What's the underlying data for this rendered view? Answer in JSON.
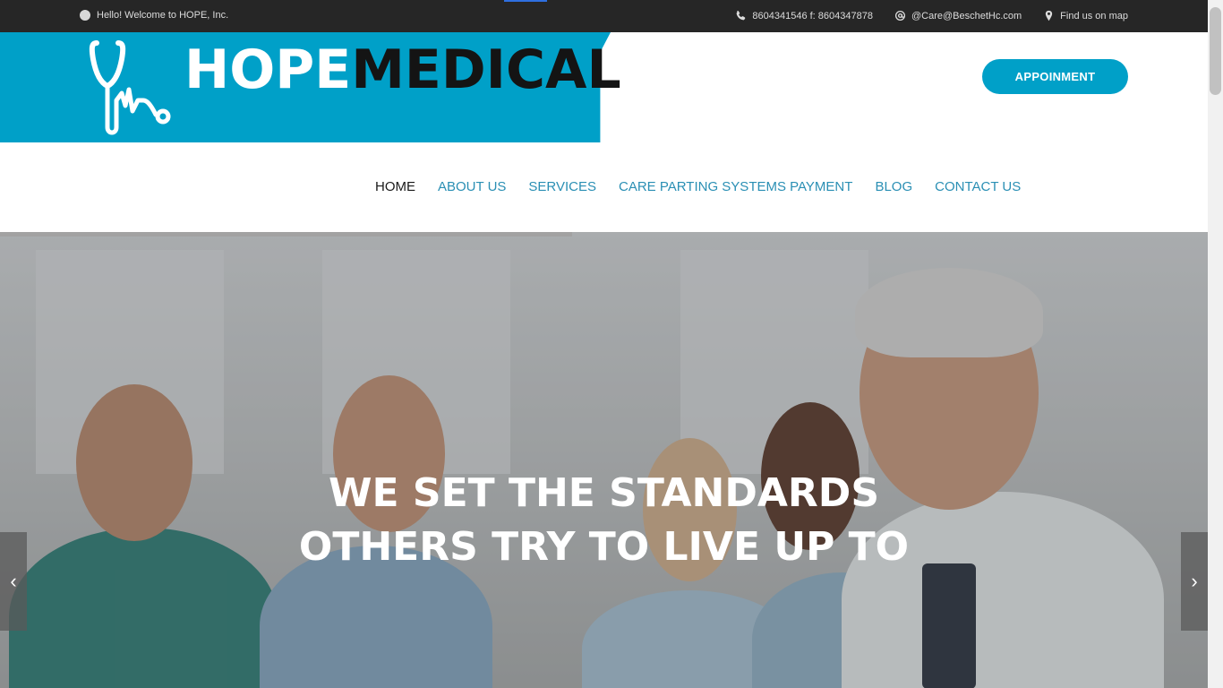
{
  "topbar": {
    "welcome": "Hello! Welcome to HOPE, Inc.",
    "phone": "8604341546 f: 8604347878",
    "email": "@Care@BeschetHc.com",
    "map": "Find us on map",
    "icons": [
      "circle-icon",
      "phone-icon",
      "at-icon",
      "map-pin-icon"
    ]
  },
  "header": {
    "logo_part1": "HOPE",
    "logo_part2": "MEDICAL",
    "appointment_button": "APPOINMENT"
  },
  "nav": {
    "items": [
      {
        "label": "HOME",
        "active": true
      },
      {
        "label": "ABOUT US",
        "active": false
      },
      {
        "label": "SERVICES",
        "active": false
      },
      {
        "label": "CARE PARTING SYSTEMS PAYMENT",
        "active": false
      },
      {
        "label": "BLOG",
        "active": false
      },
      {
        "label": "CONTACT US",
        "active": false
      }
    ]
  },
  "hero": {
    "title_line1": "WE SET THE STANDARDS",
    "title_line2": "OTHERS TRY TO LIVE UP TO",
    "prev_glyph": "‹",
    "next_glyph": "›"
  },
  "colors": {
    "brand": "#00a0c8",
    "nav_link": "#2a8fb4",
    "topbar_bg": "#262626"
  }
}
